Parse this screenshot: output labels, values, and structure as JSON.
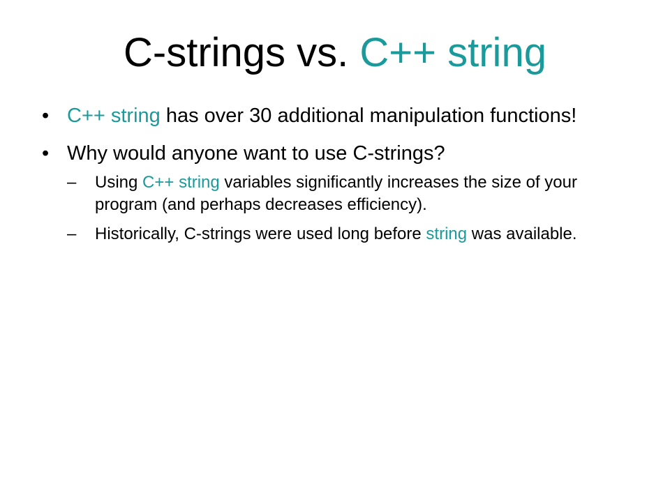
{
  "slide": {
    "title_prefix": "C-strings vs. ",
    "title_accent": "C++ string",
    "accent_color": "#1a9a9a",
    "bullet_marker": "•",
    "sub_marker": "–",
    "bullets": [
      {
        "accent": "C++ string",
        "text": " has over 30 additional manipulation functions!"
      },
      {
        "text": "Why would anyone want to use C-strings?",
        "sub": [
          {
            "before": "Using ",
            "accent": "C++ string",
            "after": " variables significantly increases the size of your program (and perhaps decreases efficiency)."
          },
          {
            "before": "Historically, C-strings were used long before ",
            "accent": "string",
            "after": " was available."
          }
        ]
      }
    ]
  }
}
